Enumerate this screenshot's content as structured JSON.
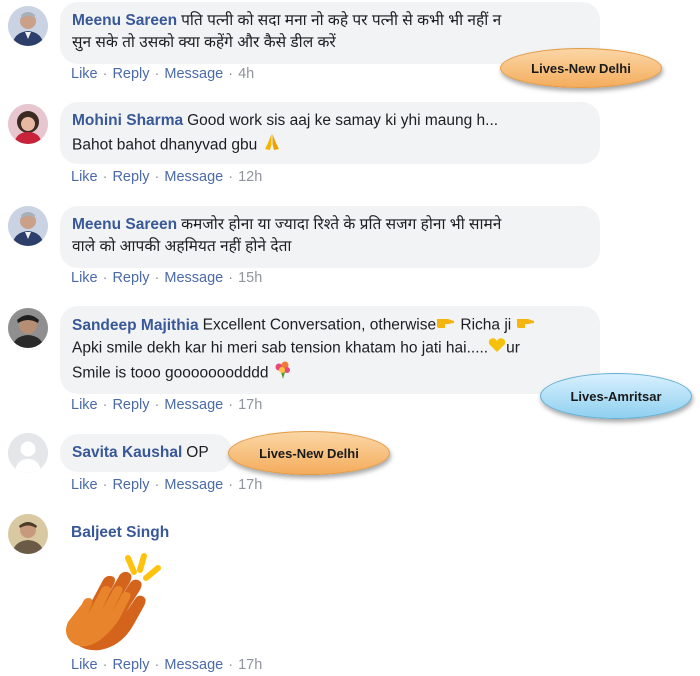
{
  "comments": [
    {
      "author": "Meenu Sareen",
      "text_line1": "पति पत्नी को सदा मना नो कहे पर पत्नी से कभी भी नहीं न",
      "text_line2": "सुन सके तो उसको क्या कहेंगे और कैसे डील करें",
      "actions": {
        "like": "Like",
        "reply": "Reply",
        "message": "Message",
        "time": "4h"
      }
    },
    {
      "author": "Mohini Sharma",
      "text_line1": "Good work sis aaj ke samay ki yhi maung h...",
      "text_line2": "Bahot bahot dhanyvad gbu",
      "emoji": "folded-hands-emoji",
      "actions": {
        "like": "Like",
        "reply": "Reply",
        "message": "Message",
        "time": "12h"
      }
    },
    {
      "author": "Meenu Sareen",
      "text_line1": "कमजोर होना या ज्यादा रिश्ते के प्रति सजग होना भी सामने",
      "text_line2": "वाले को आपकी अहमियत नहीं होने देता",
      "actions": {
        "like": "Like",
        "reply": "Reply",
        "message": "Message",
        "time": "15h"
      }
    },
    {
      "author": "Sandeep Majithia",
      "text_line1a": "Excellent Conversation, otherwise",
      "text_line1b": " Richa ji",
      "text_line2a": "Apki smile dekh kar hi meri sab tension khatam ho jati hai.....",
      "text_line2b": "ur",
      "text_line3": "Smile is tooo gooooooodddd",
      "actions": {
        "like": "Like",
        "reply": "Reply",
        "message": "Message",
        "time": "17h"
      }
    },
    {
      "author": "Savita Kaushal",
      "text": "OP",
      "actions": {
        "like": "Like",
        "reply": "Reply",
        "message": "Message",
        "time": "17h"
      }
    },
    {
      "author": "Baljeet Singh",
      "emoji": "clapping-hands-emoji",
      "actions": {
        "like": "Like",
        "reply": "Reply",
        "message": "Message",
        "time": "17h"
      }
    }
  ],
  "callouts": [
    {
      "text": "Lives-New Delhi",
      "color": "#f4ad5d"
    },
    {
      "text": "Lives-Amritsar",
      "color": "#8fd0ef"
    },
    {
      "text": "Lives-New Delhi",
      "color": "#f4ad5d"
    }
  ],
  "colors": {
    "author": "#385898",
    "link": "#4b6aa8",
    "bubble": "#f2f3f5",
    "meta": "#90949c"
  }
}
